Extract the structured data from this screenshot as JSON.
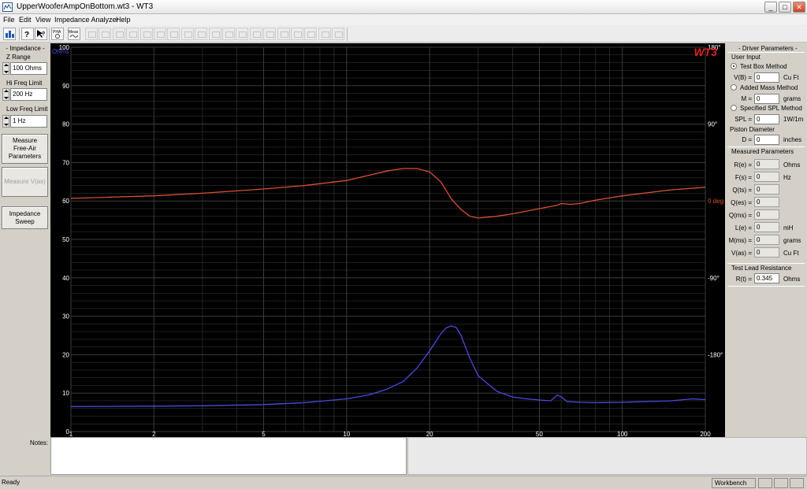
{
  "window": {
    "title": "UpperWooferAmpOnBottom.wt3 - WT3",
    "min": "_",
    "max": "□",
    "close": "✕"
  },
  "menu": [
    "File",
    "Edit",
    "View",
    "Impedance Analyzer",
    "Help"
  ],
  "toolbar": {
    "icons": [
      "open-chart-icon",
      "help-icon",
      "context-help-icon",
      "phase-icon",
      "measure-icon"
    ],
    "phase_label": "PHA",
    "meas_label": "Meas"
  },
  "left": {
    "impedance_title": "- Impedance -",
    "z_range_label": "Z Range",
    "z_range_value": "100 Ohms",
    "hi_freq_label": "Hi Freq Limit",
    "hi_freq_value": "200 Hz",
    "low_freq_label": "Low Freq Limit",
    "low_freq_value": "1 Hz",
    "measure_free_air": [
      "Measure",
      "Free-Air",
      "Parameters"
    ],
    "measure_vas": "Measure V(as)",
    "impedance_sweep": [
      "Impedance",
      "Sweep"
    ]
  },
  "chart_data": {
    "type": "line",
    "logo": "WT3",
    "x_scale": "log",
    "xlim": [
      1,
      200
    ],
    "x_ticks": [
      "1",
      "2",
      "5",
      "10",
      "20",
      "50",
      "100",
      "200"
    ],
    "y_left_unit": "Ohms",
    "y_left_lim": [
      0,
      100
    ],
    "y_left_ticks": [
      "0",
      "10",
      "20",
      "30",
      "40",
      "50",
      "60",
      "70",
      "80",
      "90",
      "100"
    ],
    "y_right_lim": [
      -270,
      180
    ],
    "y_right_ticks": [
      "180°",
      "90°",
      "0 deg",
      "-90°",
      "-180°"
    ],
    "grid": true,
    "colors": {
      "impedance": "#4a4ae0",
      "phase": "#d85030",
      "logo": "#e02020",
      "grid": "#3c3c3c",
      "background": "#000000"
    },
    "series": [
      {
        "key": "impedance",
        "axis": "left",
        "x": [
          1,
          2,
          3,
          5,
          7,
          10,
          12,
          14,
          16,
          18,
          20,
          22,
          23,
          24,
          25,
          26,
          28,
          30,
          35,
          40,
          45,
          50,
          55,
          58,
          60,
          63,
          70,
          80,
          100,
          150,
          180,
          200
        ],
        "values": [
          6.5,
          6.6,
          6.7,
          7,
          7.5,
          8.5,
          9.5,
          11,
          13,
          16.5,
          21,
          25.5,
          27,
          27.5,
          27,
          25,
          19,
          14.5,
          10.5,
          9,
          8.5,
          8.2,
          8,
          9.5,
          9,
          7.8,
          7.6,
          7.5,
          7.6,
          8,
          8.5,
          8.3
        ]
      },
      {
        "key": "phase",
        "axis": "right",
        "x": [
          1,
          2,
          3,
          5,
          7,
          10,
          12,
          14,
          16,
          18,
          20,
          22,
          24,
          26,
          28,
          30,
          35,
          40,
          50,
          58,
          60,
          65,
          70,
          80,
          100,
          150,
          200
        ],
        "values": [
          3,
          6,
          9,
          14,
          18,
          24,
          30,
          35,
          38,
          38,
          34,
          22,
          2,
          -10,
          -18,
          -20,
          -18,
          -15,
          -9,
          -5,
          -3,
          -4,
          -3,
          1,
          6,
          13,
          16
        ]
      }
    ]
  },
  "right": {
    "driver_title": "- Driver Parameters -",
    "user_input": "User Input",
    "test_box": "Test Box Method",
    "vb_label": "V(B) =",
    "vb_value": "0",
    "vb_unit": "Cu Ft",
    "added_mass": "Added Mass Method",
    "m_label": "M =",
    "m_value": "0",
    "m_unit": "grams",
    "spl_method": "Specified SPL Method",
    "spl_label": "SPL =",
    "spl_value": "0",
    "spl_unit": "1W/1m",
    "piston": "Piston Diameter",
    "d_label": "D =",
    "d_value": "0",
    "d_unit": "inches",
    "measured_title": "Measured Parameters",
    "measured": [
      {
        "label": "R(e) =",
        "value": "0",
        "unit": "Ohms"
      },
      {
        "label": "F(s) =",
        "value": "0",
        "unit": "Hz"
      },
      {
        "label": "Q(ts) =",
        "value": "0",
        "unit": ""
      },
      {
        "label": "Q(es) =",
        "value": "0",
        "unit": ""
      },
      {
        "label": "Q(ms) =",
        "value": "0",
        "unit": ""
      },
      {
        "label": "L(e) =",
        "value": "0",
        "unit": "mH"
      },
      {
        "label": "M(ms) =",
        "value": "0",
        "unit": "grams"
      },
      {
        "label": "V(as) =",
        "value": "0",
        "unit": "Cu Ft"
      }
    ],
    "lead_title": "Test Lead Resistance",
    "rt_label": "R(t) =",
    "rt_value": "0.345",
    "rt_unit": "Ohms"
  },
  "notes": {
    "label": "Notes:",
    "text": ""
  },
  "status": {
    "text": "Ready",
    "workbench": "Workbench"
  }
}
